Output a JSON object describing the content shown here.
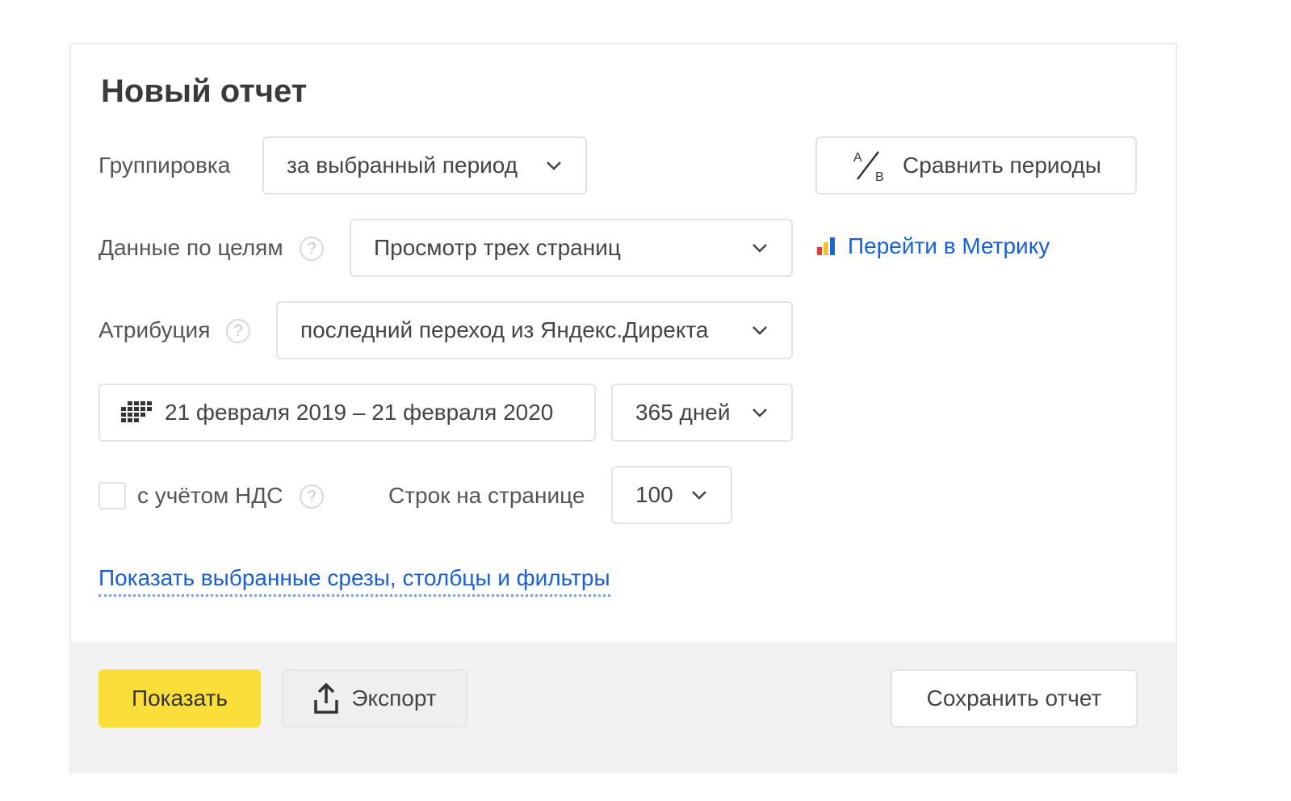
{
  "title": "Новый отчет",
  "grouping": {
    "label": "Группировка",
    "value": "за выбранный период"
  },
  "compare": {
    "label": "Сравнить периоды",
    "icon": "ab-compare-icon"
  },
  "goals": {
    "label": "Данные по целям",
    "value": "Просмотр трех страниц",
    "help": "?"
  },
  "metrika": {
    "label": "Перейти в Метрику",
    "icon": "metrika-chart-icon"
  },
  "attribution": {
    "label": "Атрибуция",
    "value": "последний переход из Яндекс.Директа",
    "help": "?"
  },
  "date_range": {
    "value": "21 февраля 2019 – 21 февраля 2020",
    "icon": "calendar-icon"
  },
  "period": {
    "value": "365 дней"
  },
  "vat": {
    "label": "с учётом НДС",
    "checked": false,
    "help": "?"
  },
  "rows_per_page": {
    "label": "Строк на странице",
    "value": "100"
  },
  "show_filters_link": "Показать выбранные срезы, столбцы и фильтры",
  "footer": {
    "show_label": "Показать",
    "export_label": "Экспорт",
    "save_label": "Сохранить отчет"
  },
  "colors": {
    "accent": "#fbde3a",
    "link": "#1a5fd6"
  }
}
